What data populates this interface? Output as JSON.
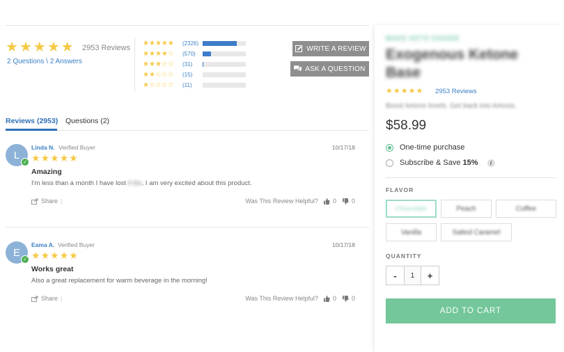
{
  "summary": {
    "rating": 5,
    "reviews_text": "2953 Reviews",
    "qa_text": "2 Questions \\ 2 Answers"
  },
  "histogram": [
    {
      "stars": 5,
      "count": "(2326)",
      "fill": 0.79
    },
    {
      "stars": 4,
      "count": "(570)",
      "fill": 0.19
    },
    {
      "stars": 3,
      "count": "(31)",
      "fill": 0.02
    },
    {
      "stars": 2,
      "count": "(15)",
      "fill": 0.0
    },
    {
      "stars": 1,
      "count": "(11)",
      "fill": 0.0
    }
  ],
  "actions": {
    "write_review": "WRITE A REVIEW",
    "ask_question": "ASK A QUESTION"
  },
  "tabs": {
    "reviews": "Reviews (2953)",
    "questions": "Questions (2)"
  },
  "reviews": [
    {
      "initial": "L",
      "author": "Linda N.",
      "badge": "Verified Buyer",
      "date": "10/17/18",
      "title": "Amazing",
      "body_before": "I'm less than a month I have lost ",
      "body_blurred": "6 lbs",
      "body_after": ". I am very excited about this product.",
      "share": "Share",
      "helpful": "Was This Review Helpful?",
      "up": "0",
      "down": "0"
    },
    {
      "initial": "E",
      "author": "Eama A.",
      "badge": "Verified Buyer",
      "date": "10/17/18",
      "title": "Works great",
      "body_before": "Also a great replacement for warm beverage in the morning!",
      "body_blurred": "",
      "body_after": "",
      "share": "Share",
      "helpful": "Was This Review Helpful?",
      "up": "0",
      "down": "0"
    }
  ],
  "product": {
    "kicker": "MAKE KETO EASIER",
    "title": "Exogenous Ketone Base",
    "reviews_link": "2953 Reviews",
    "description": "Boost ketone levels. Get back into ketosis.",
    "price": "$58.99",
    "purchase_one_time": "One-time purchase",
    "purchase_subscribe": "Subscribe & Save ",
    "subscribe_discount": "15%",
    "flavor_label": "FLAVOR",
    "flavors": [
      "Chocolate",
      "Peach",
      "Coffee",
      "Vanilla",
      "Salted Caramel"
    ],
    "selected_flavor": "Chocolate",
    "quantity_label": "QUANTITY",
    "quantity": "1",
    "minus": "-",
    "plus": "+",
    "add_to_cart": "ADD TO CART"
  },
  "colors": {
    "star": "#f6c944",
    "link": "#3b7fc4",
    "accent_green": "#73c79a",
    "button_gray": "#8e8e8e"
  }
}
